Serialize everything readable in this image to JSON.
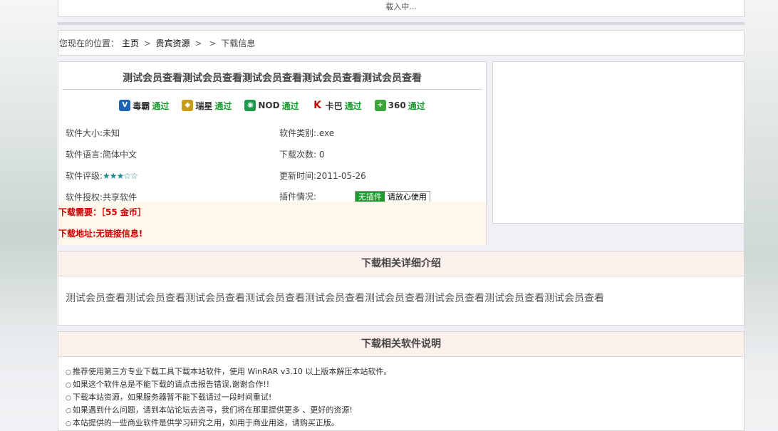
{
  "loading_text": "载入中...",
  "breadcrumb": {
    "prefix": "您现在的位置：",
    "home": "主页",
    "section": "贵宾资源",
    "current": "下载信息"
  },
  "software": {
    "title": "测试会员查看测试会员查看测试会员查看测试会员查看测试会员查看",
    "badges": [
      {
        "brand": "毒霸",
        "status": "通过"
      },
      {
        "brand": "瑞星",
        "status": "通过"
      },
      {
        "brand": "NOD",
        "status": "通过"
      },
      {
        "brand": "卡巴",
        "status": "通过"
      },
      {
        "brand": "360",
        "status": "通过"
      }
    ],
    "size": "软件大小:未知",
    "type": "软件类别:.exe",
    "language": "软件语言:简体中文",
    "downloads": "下载次数: 0",
    "rating_label": "软件评级:",
    "rating_stars": "★★★☆☆",
    "updated": "更新时间:2011-05-26",
    "license": "软件授权:共享软件",
    "plugin_label": "插件情况:",
    "plugin_badge_green": "无插件",
    "plugin_badge_text": "请放心使用",
    "need": "下载需要：［55 金币］",
    "address": "下载地址:无链接信息!"
  },
  "detail": {
    "heading": "下载相关详细介绍",
    "body": "测试会员查看测试会员查看测试会员查看测试会员查看测试会员查看测试会员查看测试会员查看测试会员查看测试会员查看"
  },
  "notes": {
    "heading": "下载相关软件说明",
    "items": [
      "推荐使用第三方专业下载工具下载本站软件，使用 WinRAR v3.10 以上版本解压本站软件。",
      "如果这个软件总是不能下载的请点击报告错误,谢谢合作!!",
      "下载本站资源，如果服务器暂不能下载请过一段时间重试!",
      "如果遇到什么问题，请到本站论坛去咨寻，我们将在那里提供更多 、更好的资源!",
      "本站提供的一些商业软件是供学习研究之用，如用于商业用途，请购买正版。"
    ]
  },
  "colors": {
    "pass_green": "#1a9b2f",
    "need_red": "#cc0000",
    "panel_head_bg": "#fbf0ec"
  }
}
